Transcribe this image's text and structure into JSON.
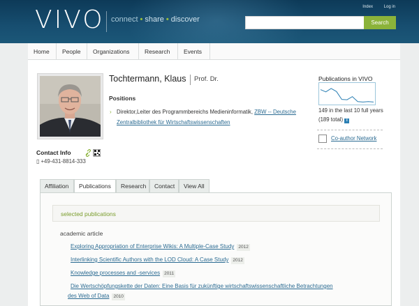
{
  "header": {
    "logo": "VIVO",
    "tagline": [
      "connect",
      "share",
      "discover"
    ],
    "utility_links": [
      "Index",
      "Log in"
    ],
    "search": {
      "placeholder": "",
      "value": "",
      "button_label": "Search"
    }
  },
  "nav": [
    "Home",
    "People",
    "Organizations",
    "Research",
    "Events"
  ],
  "profile": {
    "name": "Tochtermann, Klaus",
    "title": "Prof. Dr.",
    "positions_heading": "Positions",
    "position": {
      "role": "Direktor,Leiter des Programmbereichs Medieninformatik, ",
      "org": "ZBW -- Deutsche Zentralbibliothek für Wirtschaftswissenschaften"
    },
    "contact_heading": "Contact Info",
    "phone": "+49-431-8814-333"
  },
  "sidebar": {
    "publications_heading": "Publications in VIVO",
    "publications_text": "149 in the last 10 full years (189 total)",
    "coauthor_link": "Co-author Network",
    "sparkline": [
      0.72,
      0.6,
      0.78,
      0.62,
      0.2,
      0.18,
      0.35,
      0.08,
      0.06,
      0.08,
      0.06
    ]
  },
  "tabs": [
    "Affiliation",
    "Publications",
    "Research",
    "Contact",
    "View All"
  ],
  "active_tab": "Publications",
  "publications": {
    "section_title": "selected publications",
    "type": "academic article",
    "items": [
      {
        "title": "Exploring Appropriation of Enterprise Wikis: A Multiple-Case Study",
        "year": "2012"
      },
      {
        "title": "Interlinking Scientific Authors with the LOD Cloud: A Case Study",
        "year": "2012"
      },
      {
        "title": "Knowledge processes and -services",
        "year": "2011"
      },
      {
        "title_line1": "Die Wertschöpfungskette der Daten: Eine Basis für zukünftige wirtschaftswissenschaftliche Betrachtungen",
        "title_line2": "des Web of Data",
        "year": "2010"
      }
    ]
  },
  "colors": {
    "header": "#174e70",
    "accent_green": "#8bb33a",
    "link": "#2b6b92"
  }
}
